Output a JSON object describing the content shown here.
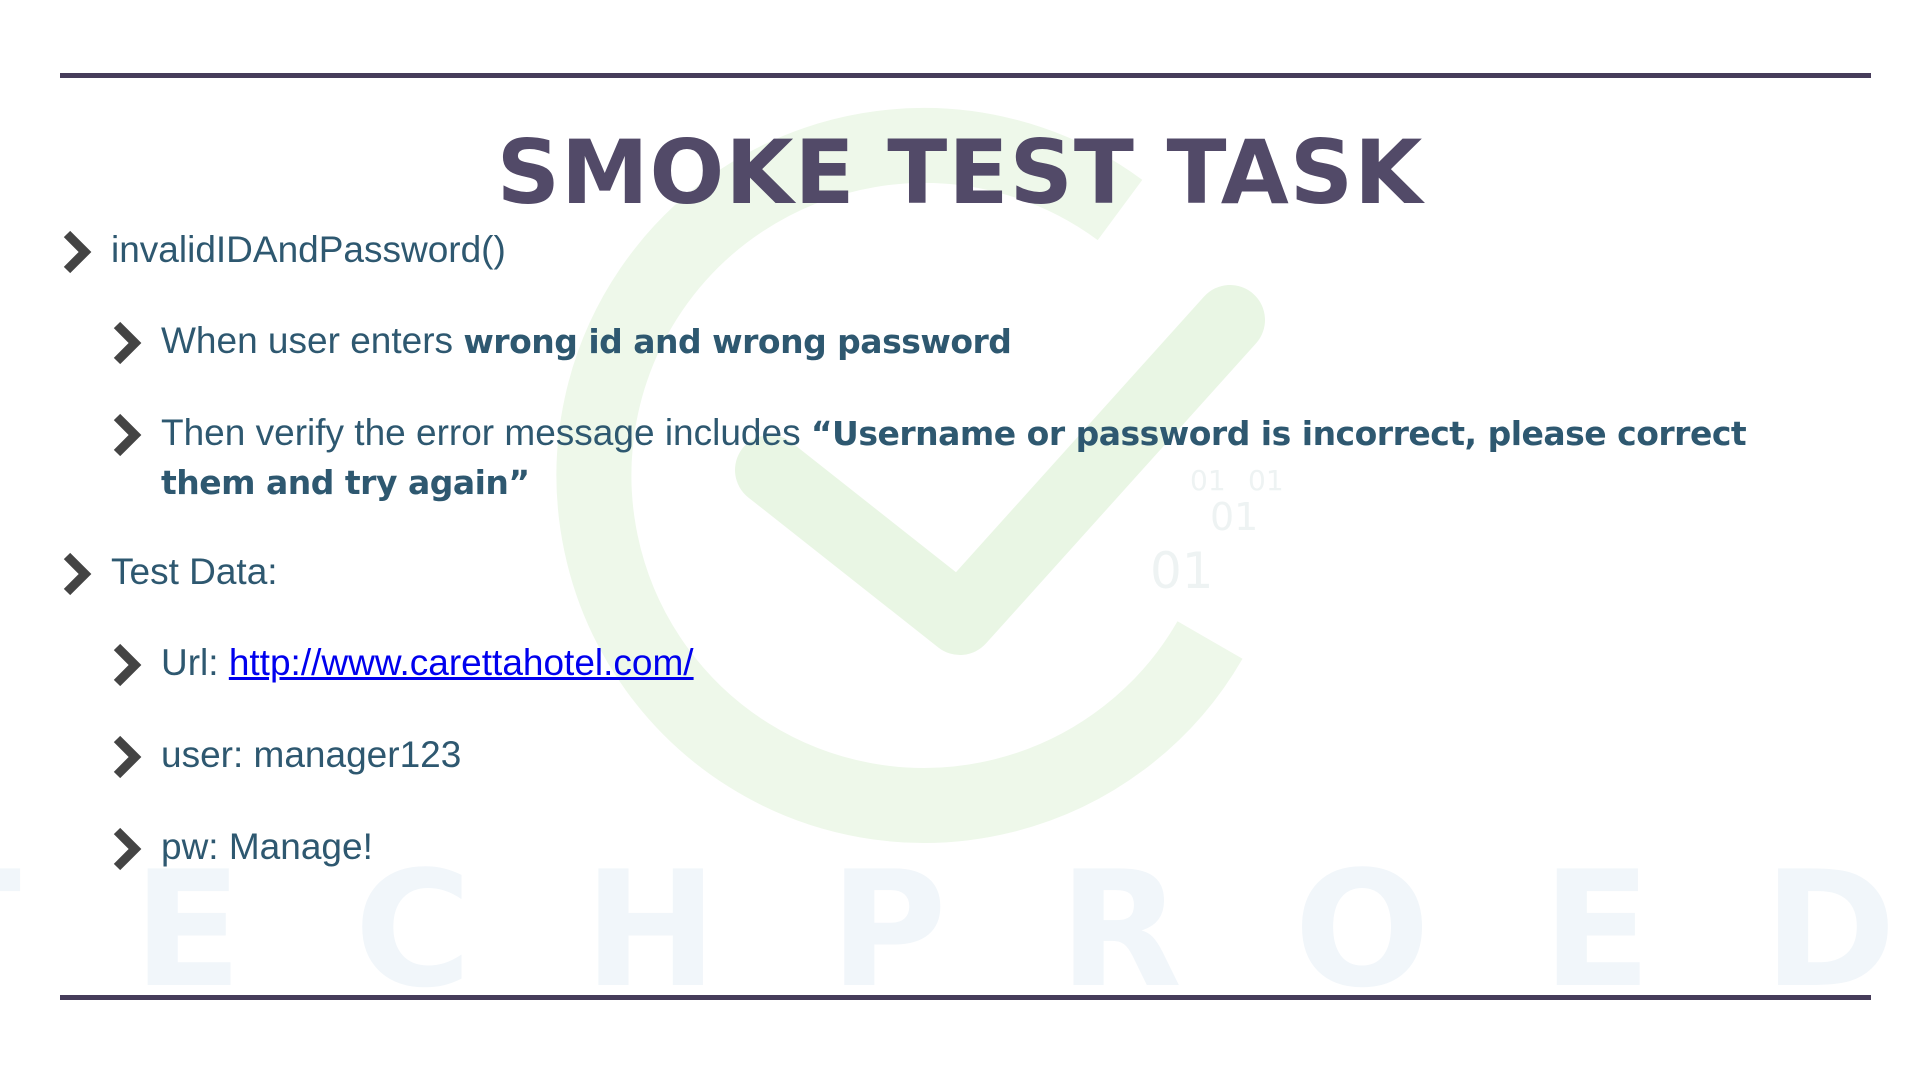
{
  "slide": {
    "title": "SMOKE TEST TASK",
    "watermark": {
      "word": "TECHPROED",
      "binary_text": "01"
    },
    "bullets": [
      {
        "level": 1,
        "text": "invalidIDAndPassword()"
      },
      {
        "level": 2,
        "text": "When user enters ",
        "bold": "wrong id and wrong password"
      },
      {
        "level": 2,
        "text": "Then verify the error message includes ",
        "bold": "“Username or password is incorrect, please correct them and try again”"
      },
      {
        "level": 1,
        "text": "Test Data:"
      },
      {
        "level": 2,
        "text": "Url: ",
        "link": "http://www.carettahotel.com/"
      },
      {
        "level": 2,
        "text": "user: manager123"
      },
      {
        "level": 2,
        "text": "pw: Manage!"
      }
    ]
  },
  "colors": {
    "title": "#524a68",
    "rule": "#463c5a",
    "bullet_text": "#2e5870",
    "chevron": "#444444",
    "link": "#0000ee",
    "watermark_green": "#eef8ea",
    "watermark_blue": "#f1f6fa"
  },
  "icons": {
    "bullet": "chevron-right-icon"
  }
}
